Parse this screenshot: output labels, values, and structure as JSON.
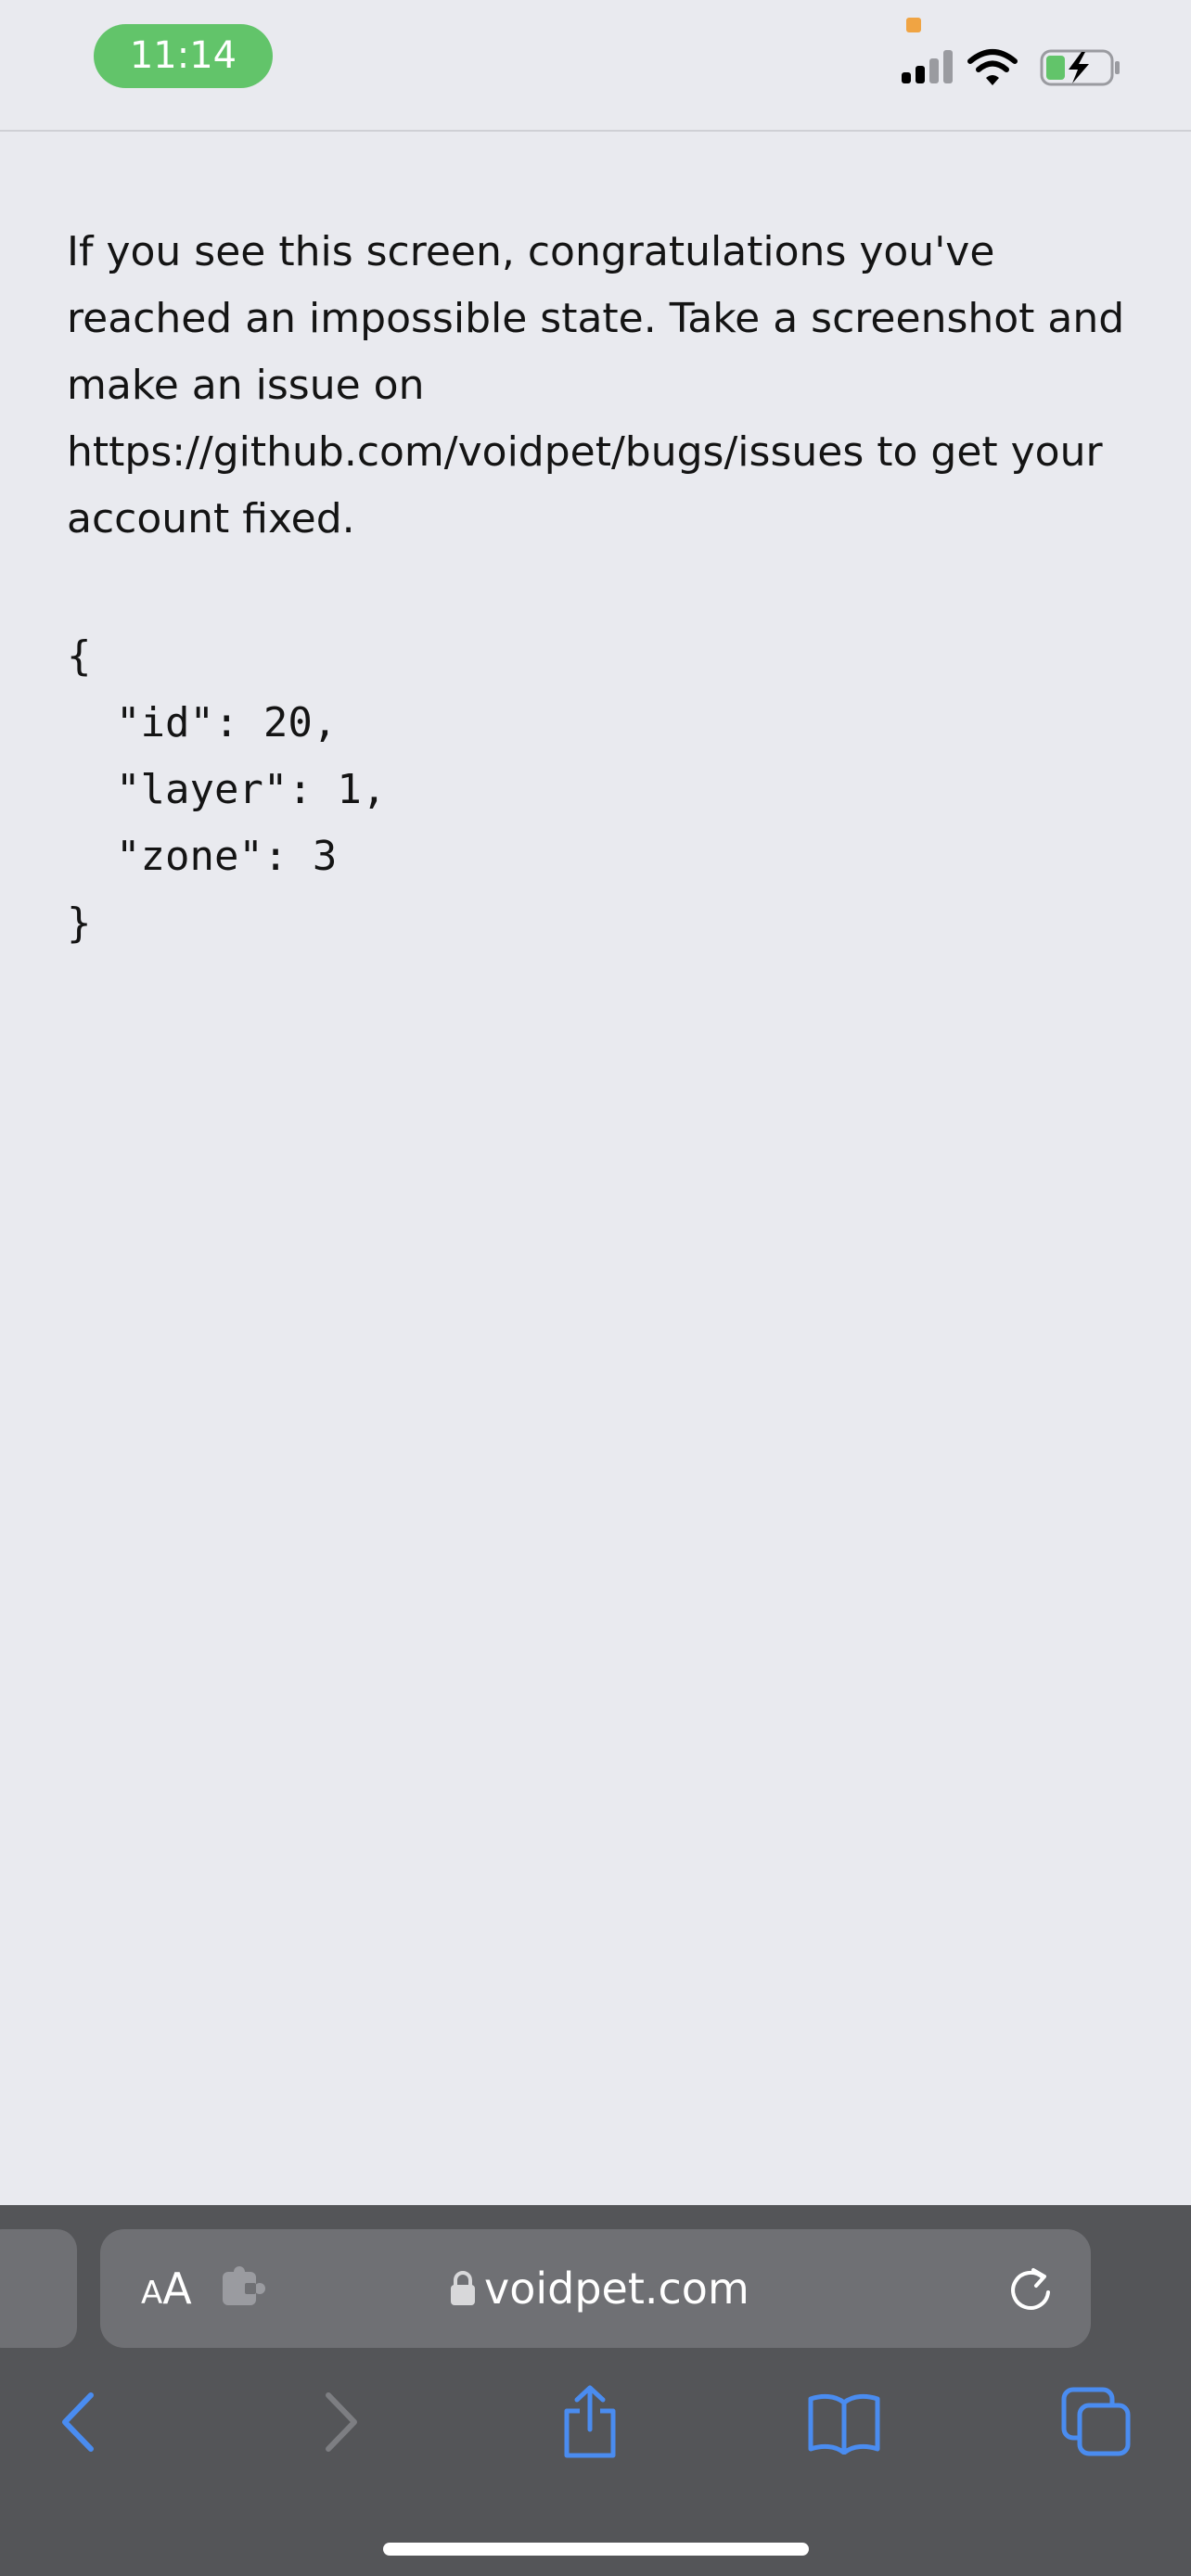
{
  "status_bar": {
    "time": "11:14",
    "icons": [
      "cellular-signal-icon",
      "wifi-icon",
      "battery-charging-icon"
    ]
  },
  "page": {
    "message": "If you see this screen, congratulations you've reached an impossible state. Take a screenshot and make an issue on https://github.com/voidpet/bugs/issues to get your account fixed.",
    "json_text": "{\n  \"id\": 20,\n  \"layer\": 1,\n  \"zone\": 3\n}"
  },
  "browser": {
    "aa_small": "A",
    "aa_large": "A",
    "url": "voidpet.com",
    "toolbar": [
      "back-button",
      "forward-button",
      "share-button",
      "bookmarks-button",
      "tabs-button"
    ]
  },
  "colors": {
    "time_pill": "#62c46a",
    "page_background": "#e9eaef",
    "toolbar_background": "#545558",
    "address_bar": "#6f7074",
    "accent_blue": "#4a8cf0",
    "privacy_indicator": "#f0a443"
  }
}
